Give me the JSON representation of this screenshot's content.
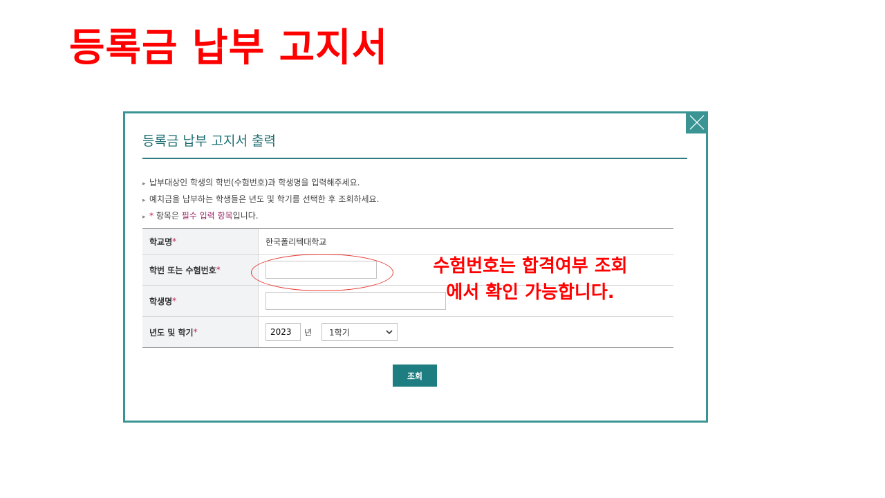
{
  "page": {
    "heading": "등록금 납부 고지서"
  },
  "modal": {
    "title": "등록금 납부 고지서 출력",
    "notes": [
      "납부대상인 학생의 학번(수험번호)과 학생명을 입력해주세요.",
      "예치금을 납부하는 학생들은 년도 및 학기를 선택한 후 조회하세요."
    ],
    "required_note": {
      "star": "*",
      "prefix": " 항목은 ",
      "highlight": "필수 입력 항목",
      "suffix": "입니다."
    },
    "form": {
      "required_mark": "*",
      "school_label": "학교명",
      "school_value": "한국폴리텍대학교",
      "id_label": "학번 또는 수험번호",
      "id_value": "",
      "name_label": "학생명",
      "name_value": "",
      "term_label": "년도 및 학기",
      "year_value": "2023",
      "year_unit": "년",
      "semester_selected": "1학기"
    },
    "search_button": "조회"
  },
  "annotation": {
    "line1": "수험번호는 합격여부 조회",
    "line2": "에서 확인 가능합니다.",
    "color": "#ff0000"
  },
  "icons": {
    "close": "close-icon",
    "bullet": "bullet-arrow-icon",
    "dropdown": "chevron-down-icon"
  },
  "colors": {
    "accent": "#3a9494",
    "title": "#1e6e72",
    "button": "#1e7d80",
    "required": "#c0235e"
  }
}
